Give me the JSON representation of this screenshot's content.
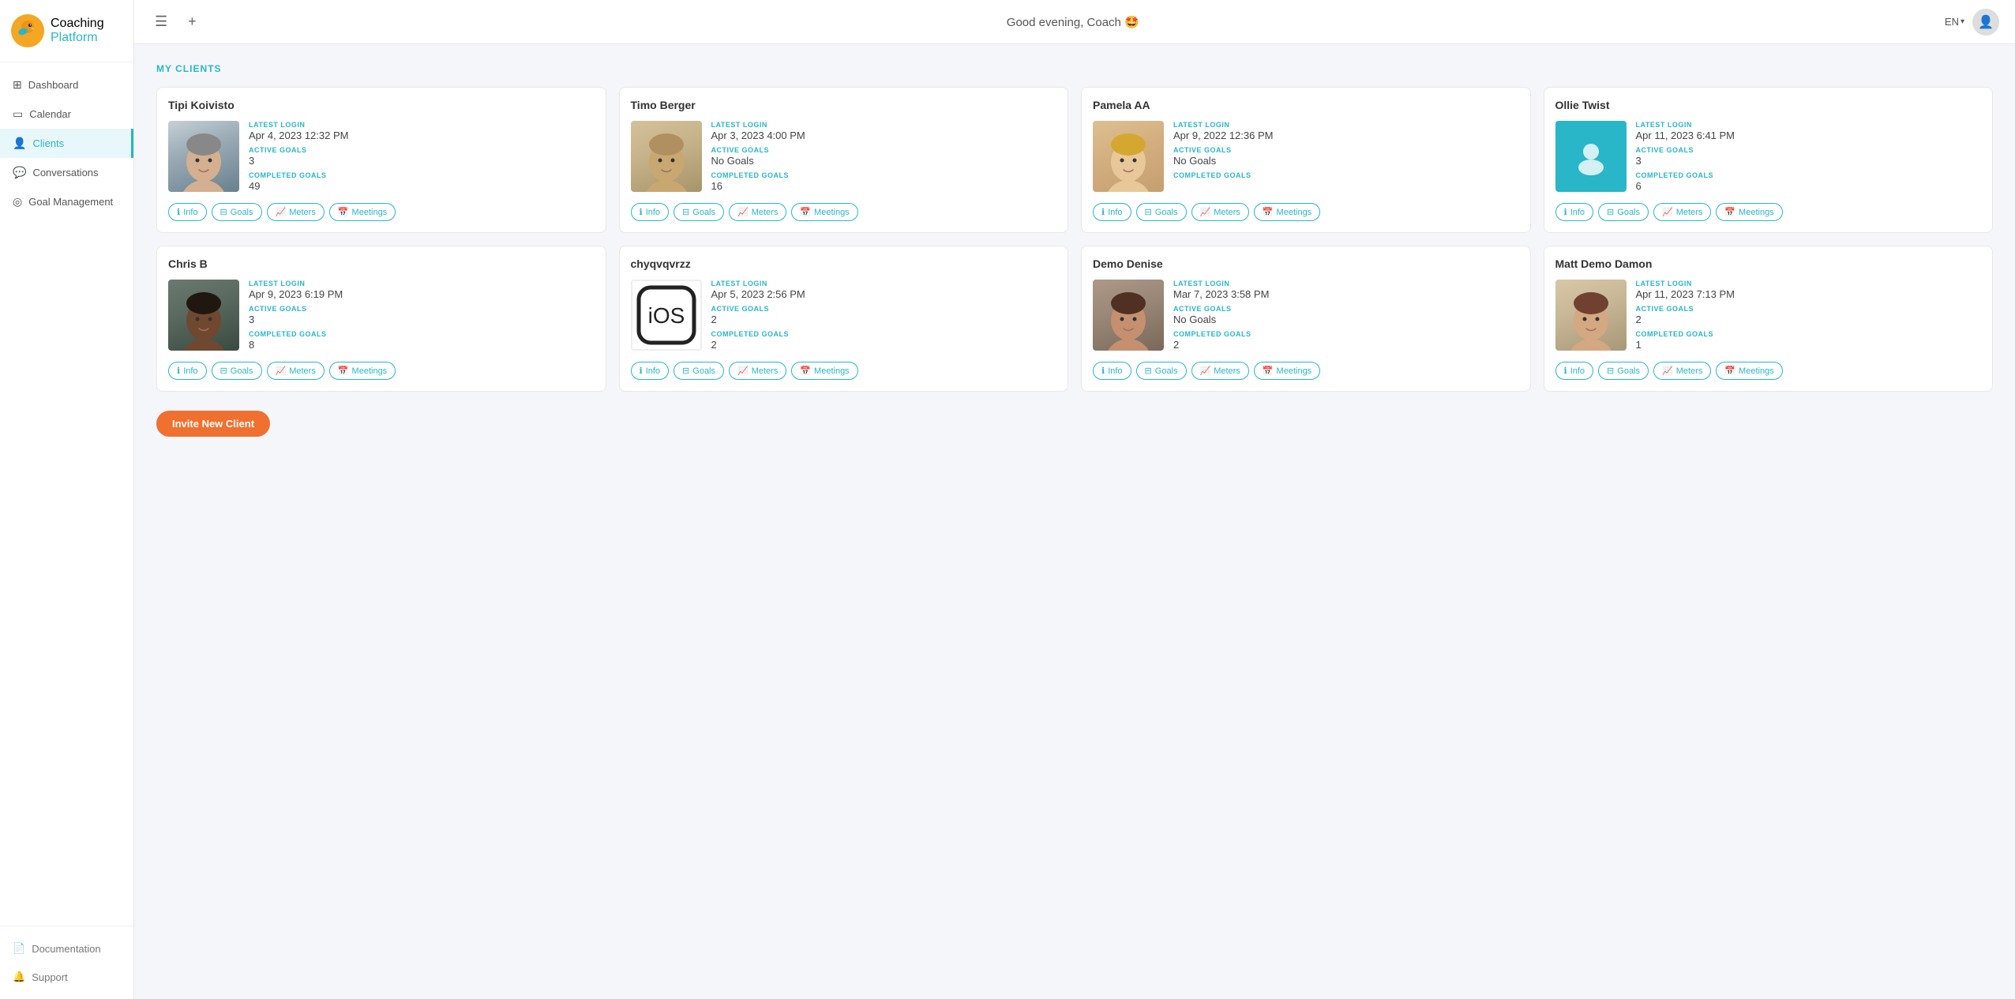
{
  "app": {
    "logo_coaching": "Coaching",
    "logo_platform": "Platform"
  },
  "topbar": {
    "greeting": "Good evening, Coach 🤩",
    "lang": "EN",
    "menu_icon": "☰",
    "add_icon": "+"
  },
  "sidebar": {
    "nav_items": [
      {
        "id": "dashboard",
        "label": "Dashboard",
        "icon": "⊞",
        "active": false
      },
      {
        "id": "calendar",
        "label": "Calendar",
        "icon": "▭",
        "active": false
      },
      {
        "id": "clients",
        "label": "Clients",
        "icon": "👤",
        "active": true
      },
      {
        "id": "conversations",
        "label": "Conversations",
        "icon": "💬",
        "active": false
      },
      {
        "id": "goal-management",
        "label": "Goal Management",
        "icon": "◎",
        "active": false
      }
    ],
    "bottom_items": [
      {
        "id": "documentation",
        "label": "Documentation",
        "icon": "📄"
      },
      {
        "id": "support",
        "label": "Support",
        "icon": "🔔"
      }
    ]
  },
  "main": {
    "section_title": "MY CLIENTS",
    "invite_button": "Invite New Client",
    "clients": [
      {
        "id": "tipi-koivisto",
        "name": "Tipi Koivisto",
        "latest_login_label": "LATEST LOGIN",
        "latest_login": "Apr 4, 2023 12:32 PM",
        "active_goals_label": "ACTIVE GOALS",
        "active_goals": "3",
        "completed_goals_label": "COMPLETED GOALS",
        "completed_goals": "49",
        "photo_type": "tipi",
        "actions": [
          "Info",
          "Goals",
          "Meters",
          "Meetings"
        ]
      },
      {
        "id": "timo-berger",
        "name": "Timo Berger",
        "latest_login_label": "LATEST LOGIN",
        "latest_login": "Apr 3, 2023 4:00 PM",
        "active_goals_label": "ACTIVE GOALS",
        "active_goals": "No Goals",
        "completed_goals_label": "COMPLETED GOALS",
        "completed_goals": "16",
        "photo_type": "timo",
        "actions": [
          "Info",
          "Goals",
          "Meters",
          "Meetings"
        ]
      },
      {
        "id": "pamela-aa",
        "name": "Pamela AA",
        "latest_login_label": "LATEST LOGIN",
        "latest_login": "Apr 9, 2022 12:36 PM",
        "active_goals_label": "ACTIVE GOALS",
        "active_goals": "No Goals",
        "completed_goals_label": "COMPLETED GOALS",
        "completed_goals": "",
        "photo_type": "pamela",
        "actions": [
          "Info",
          "Goals",
          "Meters",
          "Meetings"
        ]
      },
      {
        "id": "ollie-twist",
        "name": "Ollie Twist",
        "latest_login_label": "LATEST LOGIN",
        "latest_login": "Apr 11, 2023 6:41 PM",
        "active_goals_label": "ACTIVE GOALS",
        "active_goals": "3",
        "completed_goals_label": "COMPLETED GOALS",
        "completed_goals": "6",
        "photo_type": "placeholder",
        "actions": [
          "Info",
          "Goals",
          "Meters",
          "Meetings"
        ]
      },
      {
        "id": "chris-b",
        "name": "Chris B",
        "latest_login_label": "LATEST LOGIN",
        "latest_login": "Apr 9, 2023 6:19 PM",
        "active_goals_label": "ACTIVE GOALS",
        "active_goals": "3",
        "completed_goals_label": "COMPLETED GOALS",
        "completed_goals": "8",
        "photo_type": "chris",
        "actions": [
          "Info",
          "Goals",
          "Meters",
          "Meetings"
        ]
      },
      {
        "id": "chyqvqvrzz",
        "name": "chyqvqvrzz",
        "latest_login_label": "LATEST LOGIN",
        "latest_login": "Apr 5, 2023 2:56 PM",
        "active_goals_label": "ACTIVE GOALS",
        "active_goals": "2",
        "completed_goals_label": "COMPLETED GOALS",
        "completed_goals": "2",
        "photo_type": "ios",
        "actions": [
          "Info",
          "Goals",
          "Meters",
          "Meetings"
        ]
      },
      {
        "id": "demo-denise",
        "name": "Demo Denise",
        "latest_login_label": "LATEST LOGIN",
        "latest_login": "Mar 7, 2023 3:58 PM",
        "active_goals_label": "ACTIVE GOALS",
        "active_goals": "No Goals",
        "completed_goals_label": "COMPLETED GOALS",
        "completed_goals": "2",
        "photo_type": "demo",
        "actions": [
          "Info",
          "Goals",
          "Meters",
          "Meetings"
        ]
      },
      {
        "id": "matt-demo-damon",
        "name": "Matt Demo Damon",
        "latest_login_label": "LATEST LOGIN",
        "latest_login": "Apr 11, 2023 7:13 PM",
        "active_goals_label": "ACTIVE GOALS",
        "active_goals": "2",
        "completed_goals_label": "COMPLETED GOALS",
        "completed_goals": "1",
        "photo_type": "matt",
        "actions": [
          "Info",
          "Goals",
          "Meters",
          "Meetings"
        ]
      }
    ],
    "action_icons": {
      "Info": "ℹ",
      "Goals": "⊟",
      "Meters": "📈",
      "Meetings": "📅"
    }
  }
}
